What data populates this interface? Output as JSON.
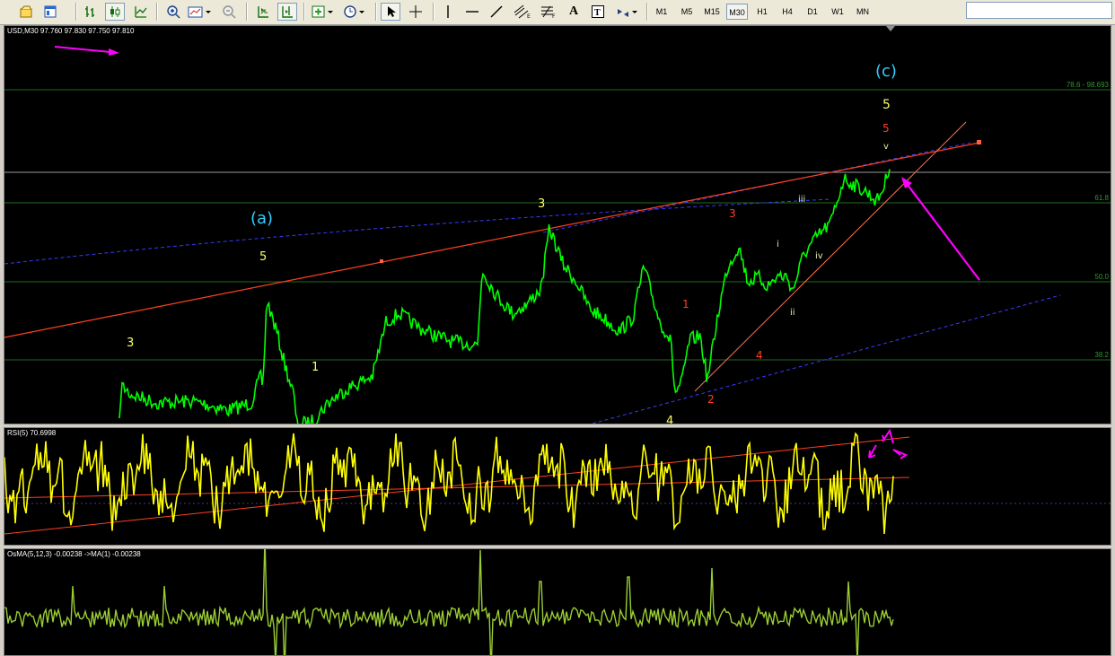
{
  "toolbar": {
    "timeframes": [
      "M1",
      "M5",
      "M15",
      "M30",
      "H1",
      "H4",
      "D1",
      "W1",
      "MN"
    ],
    "active_timeframe": "M30",
    "search_placeholder": ""
  },
  "main_chart": {
    "title": "USD,M30  97.760 97.830 97.750 97.810",
    "fib_labels": [
      "78.6 - 98.693",
      "61.8",
      "50.0",
      "38.2"
    ],
    "wave_labels": {
      "a": "(a)",
      "c": "(c)",
      "y3_left": "3",
      "y5_a": "5",
      "y1": "1",
      "y3_mid": "3",
      "y4": "4",
      "y5_top": "5",
      "r1": "1",
      "r2": "2",
      "r3": "3",
      "r4": "4",
      "r5": "5",
      "s_i": "i",
      "s_ii": "ii",
      "s_iii": "iii",
      "s_iv": "iv",
      "s_v": "v"
    },
    "colors": {
      "price": "#00ff00",
      "resistance": "#ff4020",
      "channel": "#4a4aff",
      "arrow": "#ff00ff",
      "label_yellow": "#ffff66",
      "label_cyan": "#33ccff",
      "label_red": "#ff4020"
    }
  },
  "rsi_panel": {
    "title": "RSI(5) 70.6998",
    "color": "#ffff00"
  },
  "osma_panel": {
    "title": "OsMA(5,12,3) -0.00238  ->MA(1) -0.00238",
    "color": "#9acd32"
  },
  "icons": [
    "open-chart-icon",
    "profiles-icon",
    "bar-chart-icon",
    "candles-icon",
    "line-chart-icon",
    "zoom-in-icon",
    "chart-template-icon",
    "zoom-out-icon",
    "autoscroll-icon",
    "chart-shift-icon",
    "indicators-icon",
    "periods-icon",
    "cursor-icon",
    "crosshair-icon",
    "vertical-line-icon",
    "horizontal-line-icon",
    "trendline-icon",
    "channel-icon",
    "fibonacci-icon",
    "text-icon",
    "label-icon",
    "arrows-icon"
  ]
}
